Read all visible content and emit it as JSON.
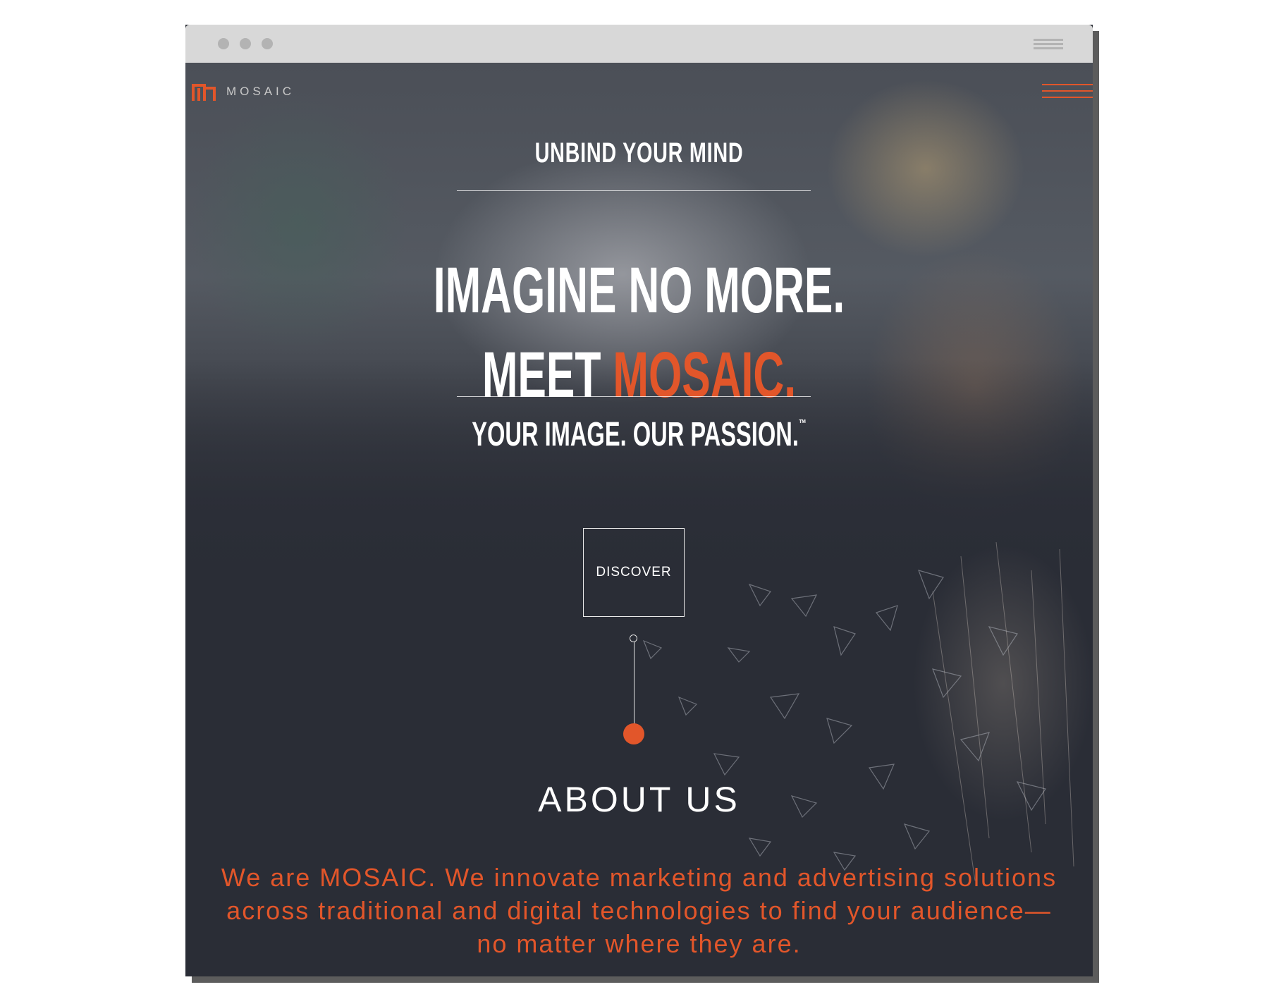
{
  "browser": {
    "controls": [
      "close-dot",
      "minimize-dot",
      "maximize-dot"
    ],
    "menu_icon": "hamburger-icon"
  },
  "brand": {
    "logo_text": "MOSAIC",
    "accent_color": "#e2562a"
  },
  "nav": {
    "menu_icon": "hamburger-icon"
  },
  "hero": {
    "tagline": "UNBIND YOUR MIND",
    "headline_line1": "IMAGINE NO MORE.",
    "headline_line2_prefix": "MEET ",
    "headline_line2_accent": "MOSAIC.",
    "subline": "YOUR IMAGE. OUR PASSION.",
    "trademark": "™",
    "cta_label": "DISCOVER"
  },
  "about": {
    "title": "ABOUT US",
    "body": "We are MOSAIC. We innovate marketing and advertising solutions across traditional and digital technologies to find your audience—no matter where they are."
  }
}
